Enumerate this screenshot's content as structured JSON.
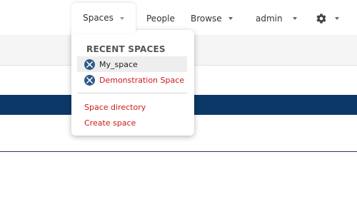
{
  "nav": {
    "spaces": "Spaces",
    "people": "People",
    "browse": "Browse",
    "admin": "admin",
    "settings_icon": "gear-icon"
  },
  "dropdown": {
    "heading": "RECENT SPACES",
    "recent": [
      {
        "label": "My_space",
        "icon": "space-icon",
        "selected": true
      },
      {
        "label": "Demonstration Space",
        "icon": "space-icon",
        "selected": false
      }
    ],
    "links": {
      "directory": "Space directory",
      "create": "Create space"
    }
  },
  "colors": {
    "accent_red": "#cc1a1a",
    "navy_bar": "#0c3868",
    "space_icon_bg": "#2c5b8a"
  }
}
